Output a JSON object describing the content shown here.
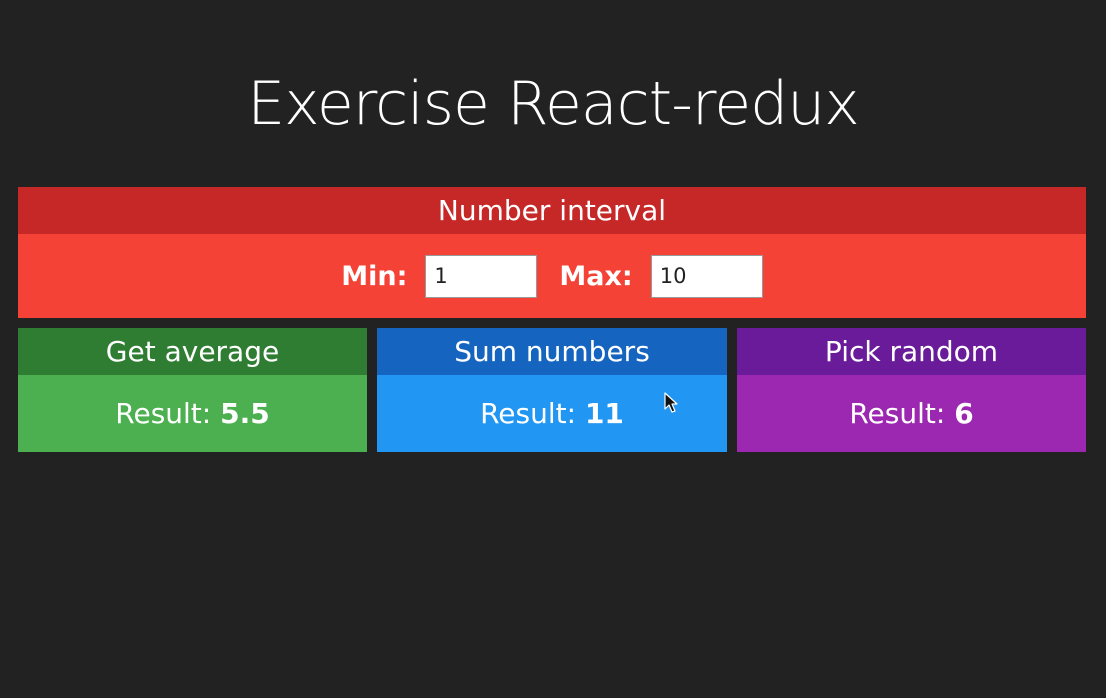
{
  "page": {
    "title": "Exercise React-redux"
  },
  "interval": {
    "header": "Number interval",
    "min_label": "Min:",
    "min_value": "1",
    "max_label": "Max:",
    "max_value": "10"
  },
  "cards": {
    "average": {
      "title": "Get average",
      "result_label": "Result:",
      "result_value": "5.5"
    },
    "sum": {
      "title": "Sum numbers",
      "result_label": "Result:",
      "result_value": "11"
    },
    "random": {
      "title": "Pick random",
      "result_label": "Result:",
      "result_value": "6"
    }
  },
  "colors": {
    "background": "#222222",
    "interval_header": "#c62828",
    "interval_body": "#f44336",
    "average_header": "#2e7d32",
    "average_body": "#4caf50",
    "sum_header": "#1565c0",
    "sum_body": "#2196f3",
    "random_header": "#6a1b9a",
    "random_body": "#9c27b0"
  },
  "icons": {
    "cursor": "mouse-pointer-icon"
  }
}
